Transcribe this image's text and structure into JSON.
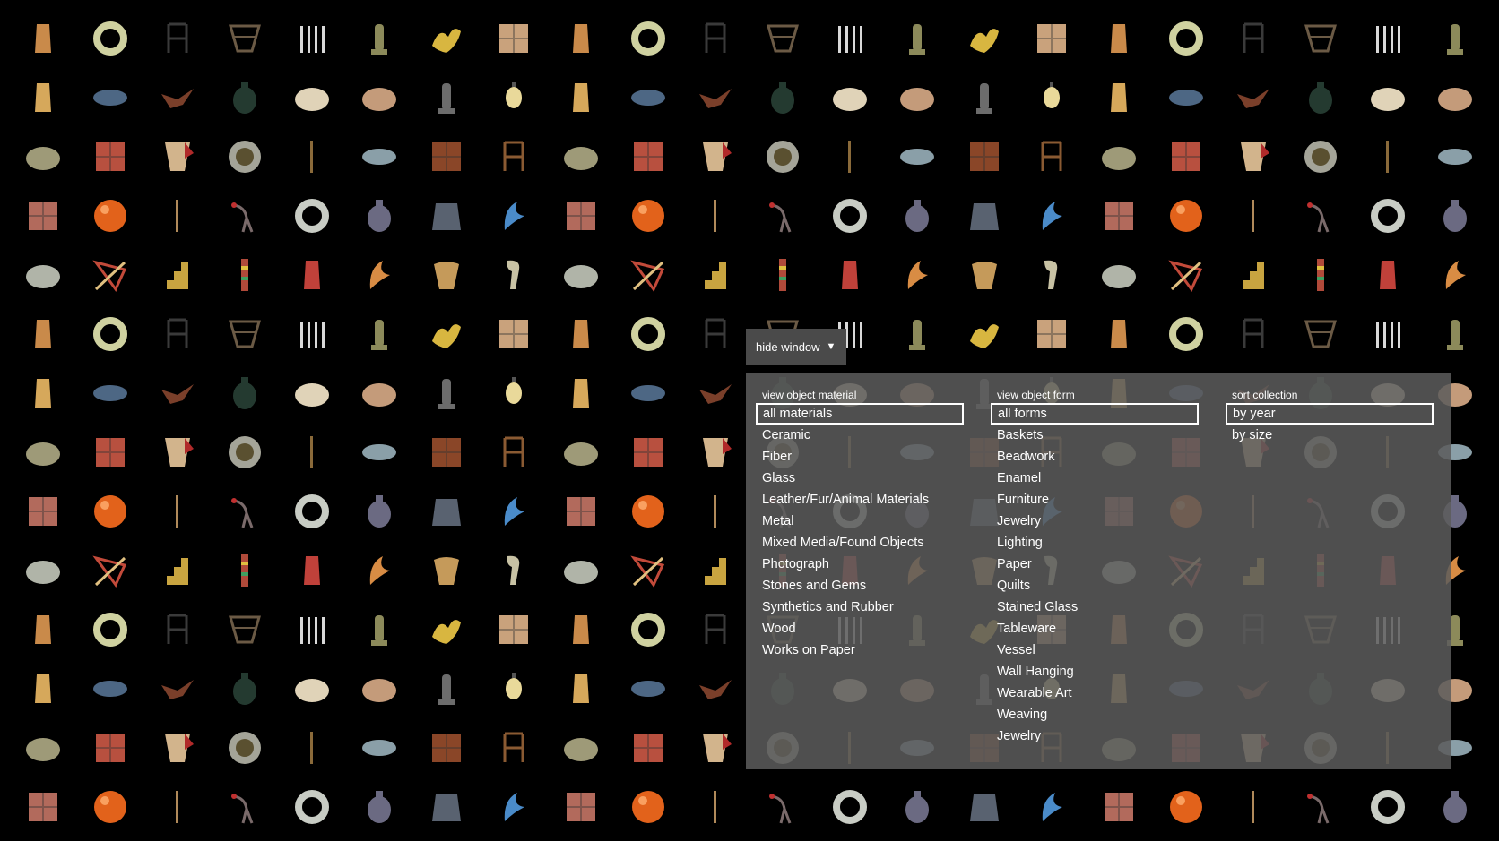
{
  "toggle": {
    "label": "hide window",
    "caret_icon": "triangle-down-icon"
  },
  "filters": {
    "material": {
      "title": "view object material",
      "selected_index": 0,
      "options": [
        "all materials",
        "Ceramic",
        "Fiber",
        "Glass",
        "Leather/Fur/Animal Materials",
        "Metal",
        "Mixed Media/Found Objects",
        "Photograph",
        "Stones and Gems",
        "Synthetics and Rubber",
        "Wood",
        "Works on Paper"
      ]
    },
    "form": {
      "title": "view object form",
      "selected_index": 0,
      "options": [
        "all forms",
        "Baskets",
        "Beadwork",
        "Enamel",
        "Furniture",
        "Jewelry",
        "Lighting",
        "Paper",
        "Quilts",
        "Stained Glass",
        "Tableware",
        "Vessel",
        "Wall Hanging",
        "Wearable Art",
        "Weaving",
        "Jewelry"
      ]
    },
    "sort": {
      "title": "sort collection",
      "selected_index": 0,
      "options": [
        "by year",
        "by size"
      ]
    }
  },
  "collection": {
    "rows": [
      [
        "vase-icon",
        "ring-icon",
        "chair-icon",
        "basket-icon",
        "cutlery-icon",
        "bust-icon",
        "gold-sculpture-icon",
        "folded-paper-icon"
      ],
      [
        "lamp-icon",
        "beaded-mat-icon",
        "bird-icon",
        "dark-vase-icon",
        "bowl-icon",
        "rock-icon",
        "bottle-icon",
        "lantern-icon"
      ],
      [
        "spiky-bowl-icon",
        "quilt-icon",
        "cloth-icon",
        "plate-icon",
        "stick-icon",
        "bracelet-icon",
        "tile-icon",
        "wood-chair-icon"
      ],
      [
        "panel-icon",
        "orange-sphere-icon",
        "rod-icon",
        "heron-icon",
        "wreath-icon",
        "round-bottle-icon",
        "coat-icon",
        "blue-glass-icon"
      ],
      [
        "metal-bowl-icon",
        "kite-icon",
        "stair-icon",
        "bead-strand-icon",
        "red-vase-icon",
        "leaf-icon",
        "shell-icon",
        "lamp-sculpture-icon"
      ]
    ],
    "colors": {
      "vase-icon": "#c98a4a",
      "ring-icon": "#cfd1a0",
      "chair-icon": "#3a3a3a",
      "basket-icon": "#6b5a45",
      "cutlery-icon": "#d9d9d9",
      "bust-icon": "#8c8a5a",
      "gold-sculpture-icon": "#d8b640",
      "folded-paper-icon": "#c9a27c",
      "lamp-icon": "#d6a85b",
      "beaded-mat-icon": "#4d6784",
      "bird-icon": "#7a3f2a",
      "dark-vase-icon": "#243a30",
      "bowl-icon": "#e0d3b8",
      "rock-icon": "#c49b7a",
      "bottle-icon": "#6c6c6c",
      "lantern-icon": "#e9d99a",
      "spiky-bowl-icon": "#9e9a78",
      "quilt-icon": "#b8503f",
      "cloth-icon": "#d2b48c",
      "plate-icon": "#a4a498",
      "stick-icon": "#8a6a3a",
      "bracelet-icon": "#8a9fa8",
      "tile-icon": "#8a4628",
      "wood-chair-icon": "#8a5a32",
      "panel-icon": "#b26a5c",
      "orange-sphere-icon": "#e2621b",
      "rod-icon": "#b08a5a",
      "heron-icon": "#7a6a6a",
      "wreath-icon": "#c8ccc4",
      "round-bottle-icon": "#6b6a82",
      "coat-icon": "#596270",
      "blue-glass-icon": "#4a8bc9",
      "metal-bowl-icon": "#b0b4a8",
      "kite-icon": "#c24a3a",
      "stair-icon": "#c8a440",
      "bead-strand-icon": "#b04a3a",
      "red-vase-icon": "#c0413a",
      "leaf-icon": "#d88c44",
      "shell-icon": "#c59a5a",
      "lamp-sculpture-icon": "#c8c2a4"
    }
  }
}
